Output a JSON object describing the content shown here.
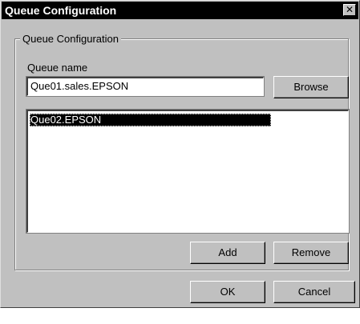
{
  "window": {
    "title": "Queue Configuration",
    "close_glyph": "✕"
  },
  "group": {
    "legend": "Queue Configuration"
  },
  "queue_name": {
    "label": "Queue name",
    "value": "Que01.sales.EPSON",
    "browse_label": "Browse"
  },
  "queue_list": {
    "items": [
      "Que02.EPSON"
    ],
    "selected_index": 0
  },
  "buttons": {
    "add": "Add",
    "remove": "Remove",
    "ok": "OK",
    "cancel": "Cancel"
  },
  "colors": {
    "titlebar": "#000000",
    "face": "#c0c0c0",
    "selection": "#000000"
  },
  "icons": {
    "close": "close-icon"
  }
}
